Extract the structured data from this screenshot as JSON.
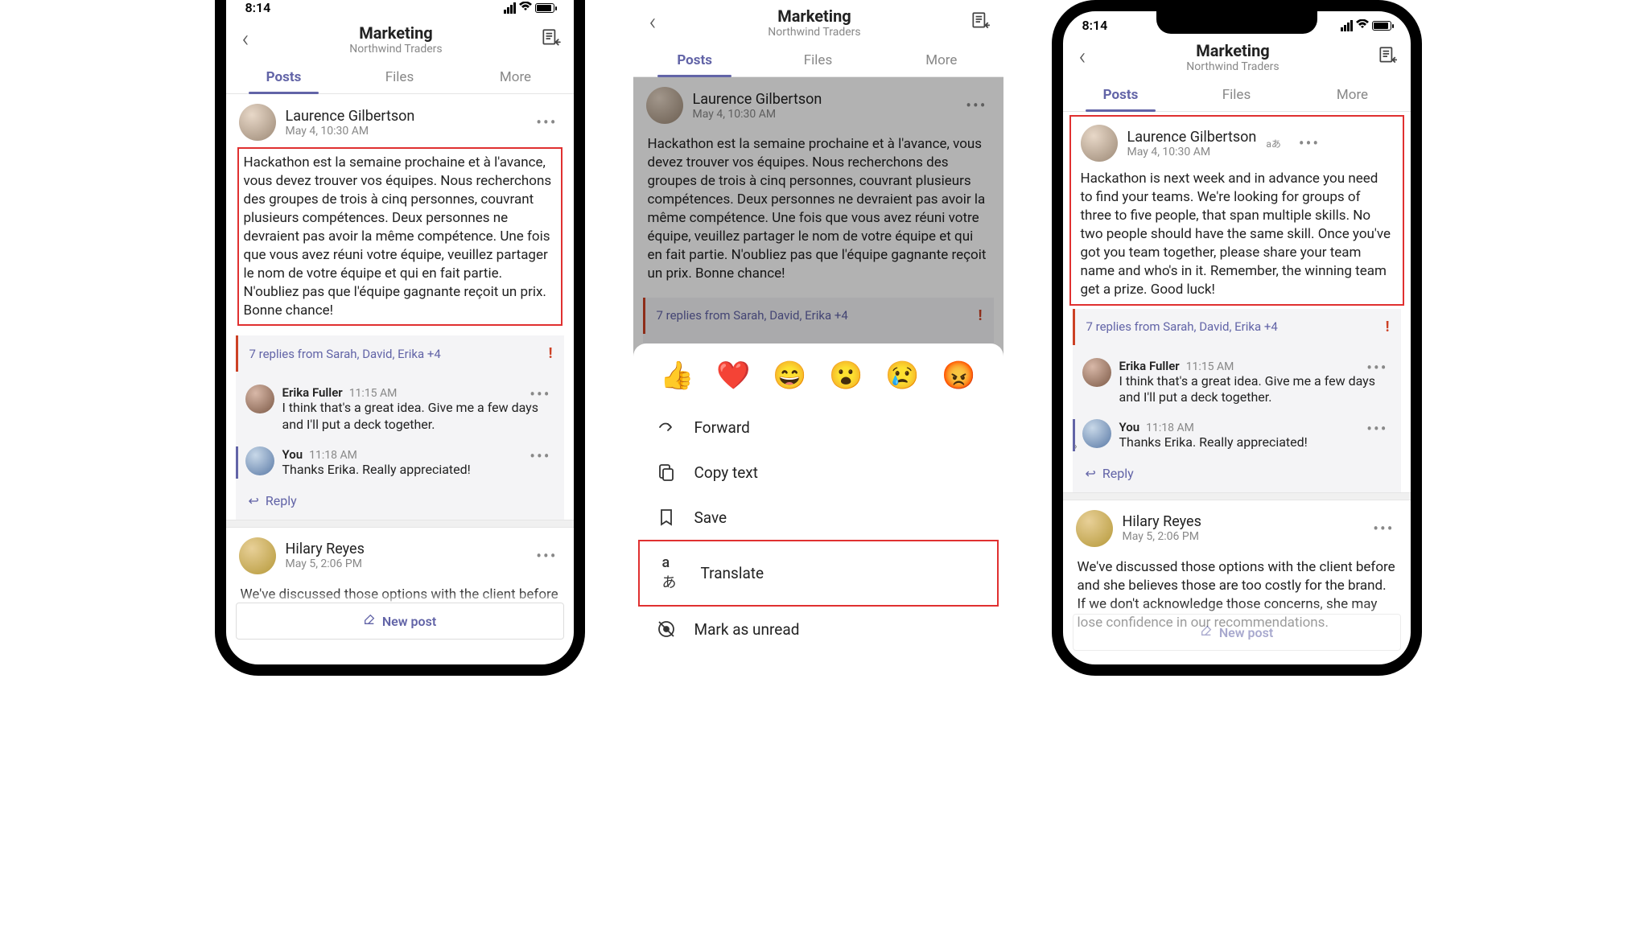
{
  "status": {
    "time": "8:14"
  },
  "header": {
    "title": "Marketing",
    "subtitle": "Northwind Traders"
  },
  "tabs": {
    "posts": "Posts",
    "files": "Files",
    "more": "More"
  },
  "post1": {
    "author": "Laurence Gilbertson",
    "time": "May 4, 10:30 AM",
    "body_fr": "Hackathon est la semaine prochaine et à l'avance, vous devez trouver vos équipes. Nous recherchons des groupes de trois à cinq personnes, couvrant plusieurs compétences. Deux personnes ne devraient pas avoir la même compétence. Une fois que vous avez réuni votre équipe, veuillez partager le nom de votre équipe et qui en fait partie. N'oubliez pas que l'équipe gagnante reçoit un prix. Bonne chance!",
    "body_en": "Hackathon is next week and in advance you need to find your teams. We're looking for groups of three to five people, that span multiple skills. No two people should have the same skill. Once you've got you team together, please share your team name and who's in it. Remember, the winning team get a prize. Good luck!",
    "replies_summary": "7 replies from Sarah, David, Erika +4"
  },
  "reply1": {
    "author": "Erika Fuller",
    "time": "11:15 AM",
    "text": "I think that's a great idea. Give me a few days and I'll put a deck together."
  },
  "reply2": {
    "author": "You",
    "time": "11:18 AM",
    "text": "Thanks Erika. Really appreciated!"
  },
  "reply_link": "Reply",
  "post2": {
    "author": "Hilary Reyes",
    "time": "May 5, 2:06 PM",
    "body_short": "We've discussed those options with the client before and she believes those are too costly for the brand. If we don't acknowledge those",
    "body_long": "We've discussed those options with the client before and she believes those are too costly for the brand. If we don't acknowledge those concerns, she may lose confidence in our recommendations."
  },
  "newpost": "New post",
  "actions": {
    "forward": "Forward",
    "copy": "Copy text",
    "save": "Save",
    "translate": "Translate",
    "unread": "Mark as unread"
  },
  "reactions": [
    "👍",
    "❤️",
    "😄",
    "😮",
    "😢",
    "😡"
  ]
}
